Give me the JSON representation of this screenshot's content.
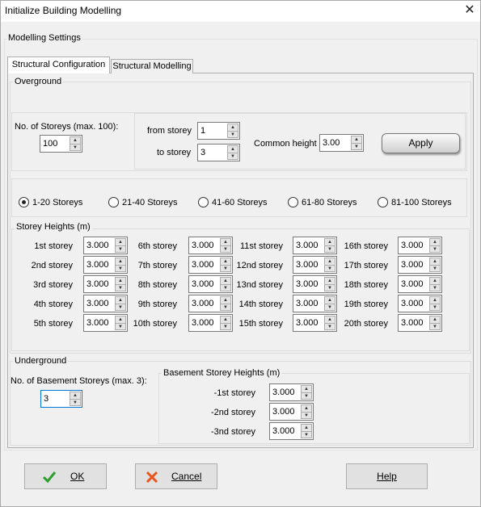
{
  "window": {
    "title": "Initialize Building Modelling",
    "close_glyph": "✕"
  },
  "settings_label": "Modelling Settings",
  "tabs": [
    "Structural Configuration",
    "Structural Modelling"
  ],
  "overground": {
    "label": "Overground",
    "storeys_label": "No. of Storeys (max. 100):",
    "storeys_value": "100",
    "from_label": "from storey",
    "from_value": "1",
    "to_label": "to storey",
    "to_value": "3",
    "common_label": "Common height",
    "common_value": "3.00",
    "apply_label": "Apply",
    "ranges": [
      "1-20 Storeys",
      "21-40 Storeys",
      "41-60 Storeys",
      "61-80 Storeys",
      "81-100 Storeys"
    ],
    "selected_range": 0,
    "heights_label": "Storey Heights (m)",
    "storeys": [
      {
        "label": "1st storey",
        "value": "3.000"
      },
      {
        "label": "2nd storey",
        "value": "3.000"
      },
      {
        "label": "3rd storey",
        "value": "3.000"
      },
      {
        "label": "4th storey",
        "value": "3.000"
      },
      {
        "label": "5th storey",
        "value": "3.000"
      },
      {
        "label": "6th storey",
        "value": "3.000"
      },
      {
        "label": "7th storey",
        "value": "3.000"
      },
      {
        "label": "8th storey",
        "value": "3.000"
      },
      {
        "label": "9th storey",
        "value": "3.000"
      },
      {
        "label": "10th storey",
        "value": "3.000"
      },
      {
        "label": "11st storey",
        "value": "3.000"
      },
      {
        "label": "12nd storey",
        "value": "3.000"
      },
      {
        "label": "13nd storey",
        "value": "3.000"
      },
      {
        "label": "14th storey",
        "value": "3.000"
      },
      {
        "label": "15th storey",
        "value": "3.000"
      },
      {
        "label": "16th storey",
        "value": "3.000"
      },
      {
        "label": "17th storey",
        "value": "3.000"
      },
      {
        "label": "18th storey",
        "value": "3.000"
      },
      {
        "label": "19th storey",
        "value": "3.000"
      },
      {
        "label": "20th storey",
        "value": "3.000"
      }
    ]
  },
  "underground": {
    "label": "Underground",
    "basement_label": "No. of Basement Storeys (max. 3):",
    "basement_value": "3",
    "heights_label": "Basement Storey Heights (m)",
    "basements": [
      {
        "label": "-1st storey",
        "value": "3.000"
      },
      {
        "label": "-2nd storey",
        "value": "3.000"
      },
      {
        "label": "-3nd storey",
        "value": "3.000"
      }
    ]
  },
  "buttons": {
    "ok": "OK",
    "cancel": "Cancel",
    "help": "Help"
  },
  "colors": {
    "ok_check": "#2e9e2e",
    "cancel_x": "#e8541e"
  }
}
